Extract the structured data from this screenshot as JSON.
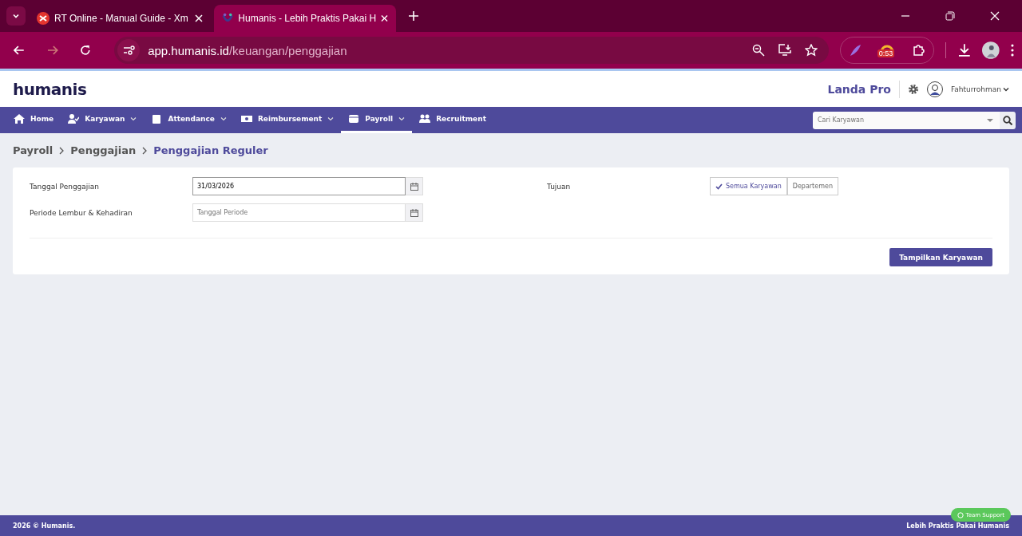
{
  "browser": {
    "tabs": [
      {
        "title": "RT Online - Manual Guide - Xm",
        "selected": false
      },
      {
        "title": "Humanis - Lebih Praktis Pakai H",
        "selected": true
      }
    ],
    "url_host": "app.humanis.id",
    "url_path": "/keuangan/penggajian",
    "extension_badge": "0:53"
  },
  "header": {
    "logo": "humanis",
    "company": "Landa Pro",
    "user": "Fahturrohman"
  },
  "nav": [
    {
      "label": "Home",
      "dropdown": false,
      "selected": false
    },
    {
      "label": "Karyawan",
      "dropdown": true,
      "selected": false
    },
    {
      "label": "Attendance",
      "dropdown": true,
      "selected": false
    },
    {
      "label": "Reimbursement",
      "dropdown": true,
      "selected": false
    },
    {
      "label": "Payroll",
      "dropdown": true,
      "selected": true
    },
    {
      "label": "Recruitment",
      "dropdown": false,
      "selected": false
    }
  ],
  "search": {
    "placeholder": "Cari Karyawan"
  },
  "breadcrumb": [
    "Payroll",
    "Penggajian",
    "Penggajian Reguler"
  ],
  "form": {
    "fields": [
      {
        "label": "Tanggal Penggajian",
        "value": "31/03/2026"
      },
      {
        "label": "Periode Lembur & Kehadiran",
        "placeholder": "Tanggal Periode"
      }
    ],
    "target_label": "Tujuan",
    "target_options": [
      {
        "label": "Semua Karyawan",
        "selected": true
      },
      {
        "label": "Departemen",
        "selected": false
      }
    ],
    "submit": "Tampilkan Karyawan"
  },
  "footer": {
    "left": "2026 © Humanis.",
    "right": "Lebih Praktis Pakai Humanis",
    "support": "Team Support"
  }
}
